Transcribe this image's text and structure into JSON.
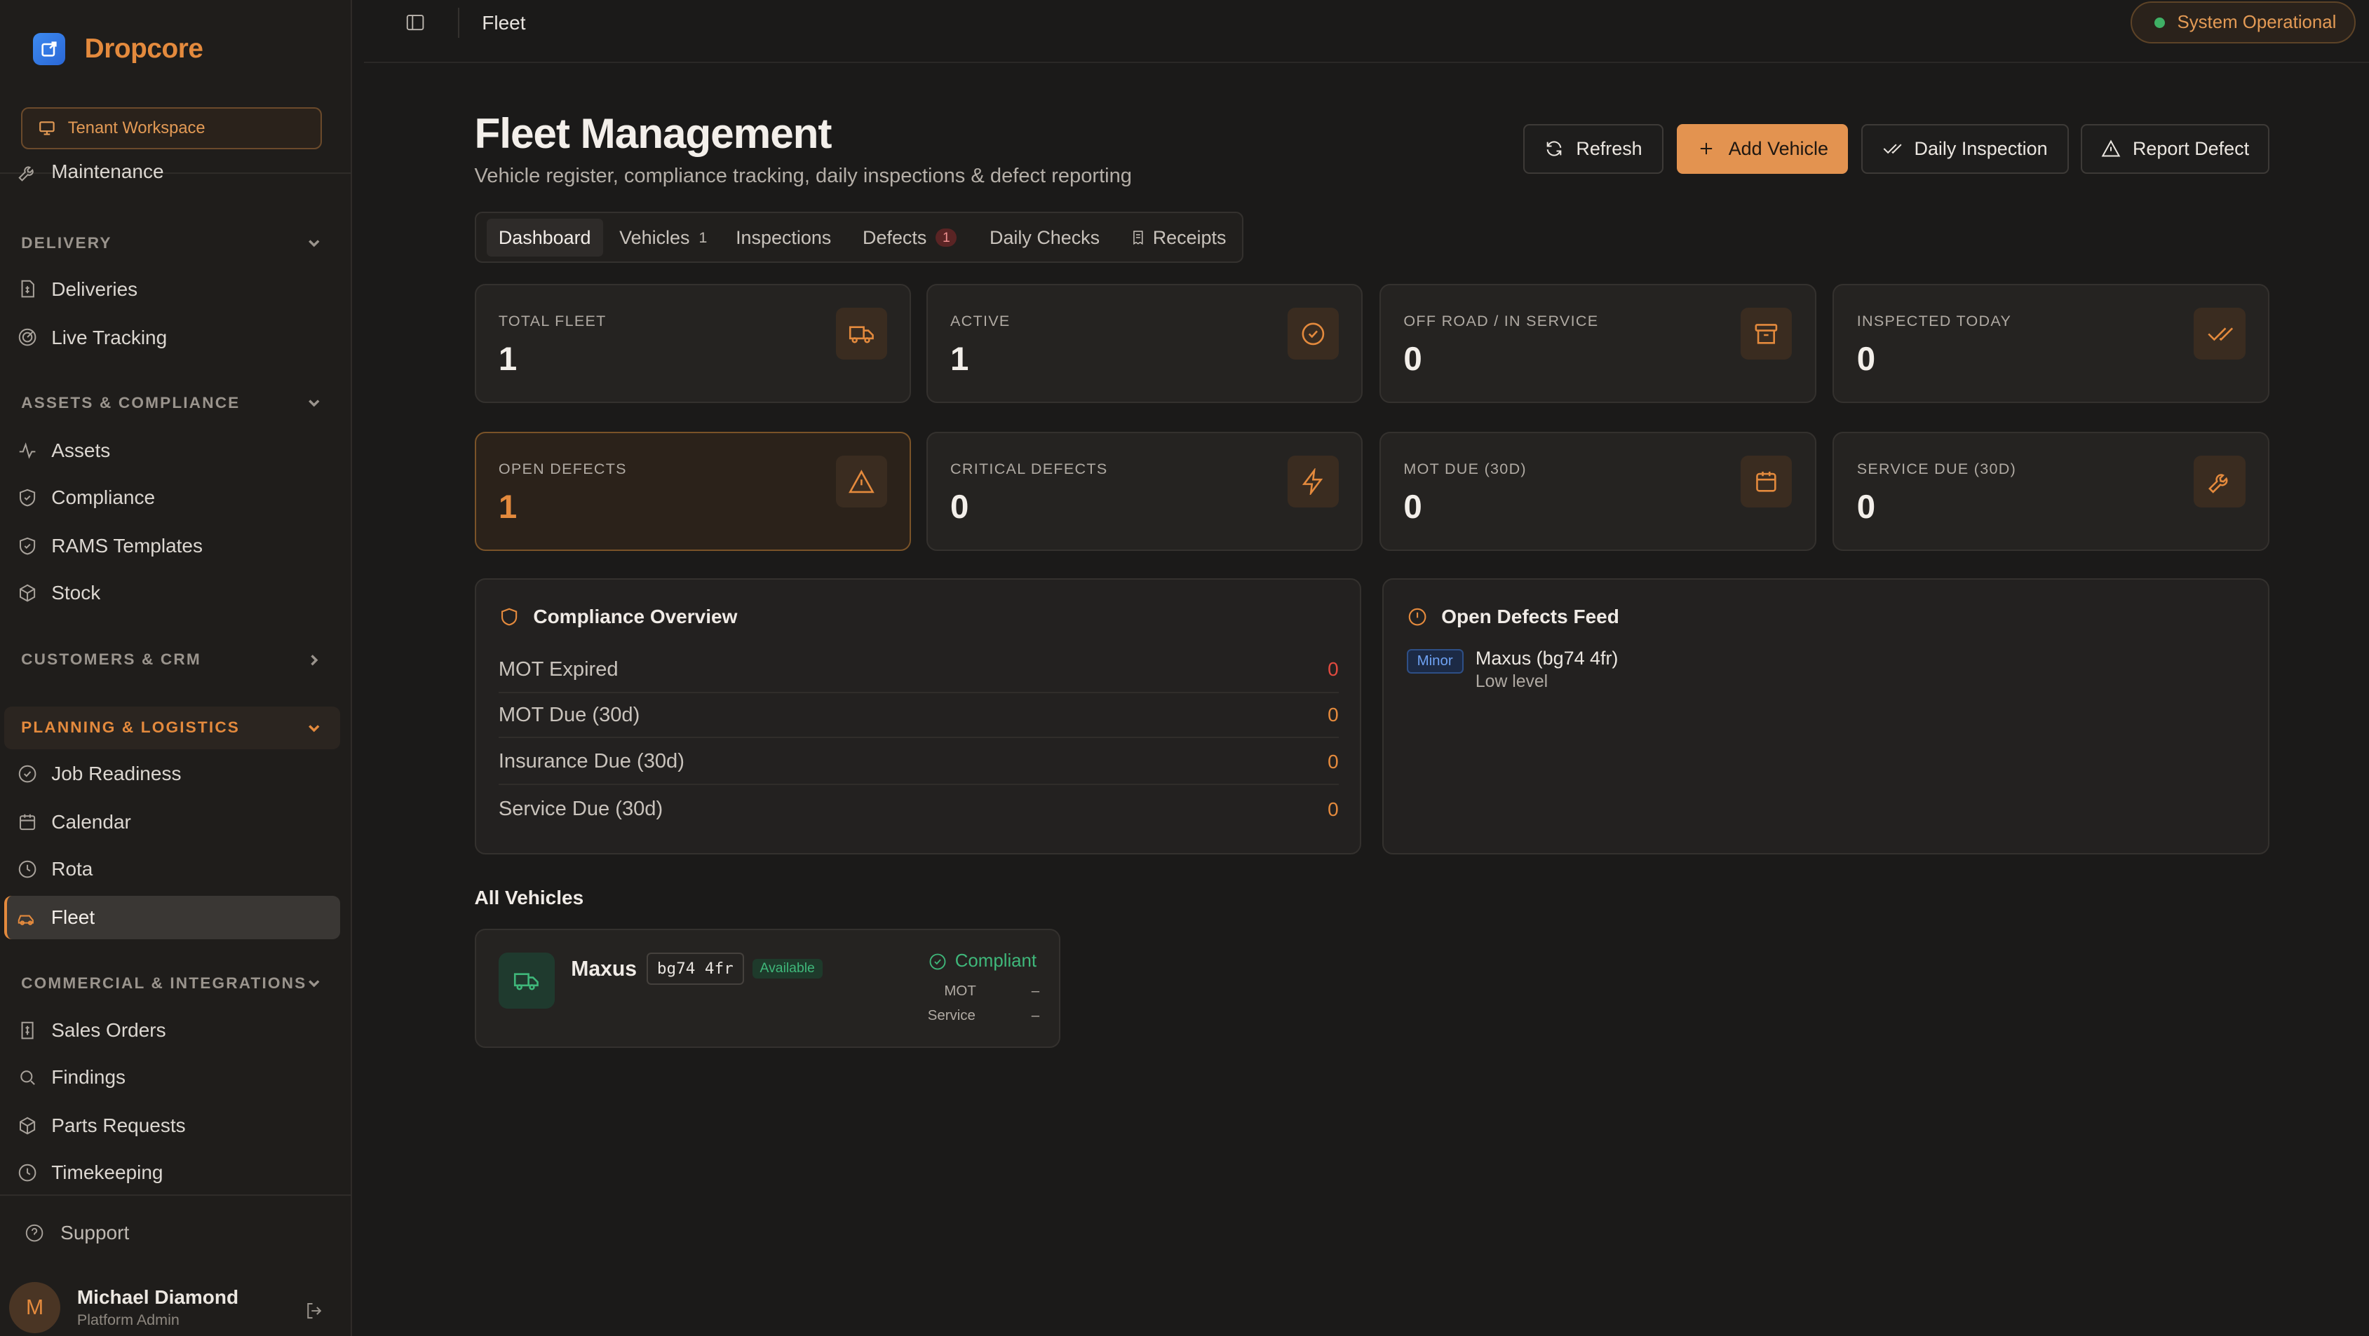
{
  "brand": {
    "name": "Dropcore"
  },
  "tenant": {
    "label": "Tenant Workspace"
  },
  "sidebar": {
    "top_partial": "Maintenance",
    "sections": [
      {
        "label": "DELIVERY",
        "items": [
          "Deliveries",
          "Live Tracking"
        ]
      },
      {
        "label": "ASSETS & COMPLIANCE",
        "items": [
          "Assets",
          "Compliance",
          "RAMS Templates",
          "Stock"
        ]
      },
      {
        "label": "CUSTOMERS & CRM",
        "items": []
      },
      {
        "label": "PLANNING & LOGISTICS",
        "items": [
          "Job Readiness",
          "Calendar",
          "Rota",
          "Fleet"
        ]
      },
      {
        "label": "COMMERCIAL & INTEGRATIONS",
        "items": [
          "Sales Orders",
          "Findings",
          "Parts Requests",
          "Timekeeping"
        ]
      }
    ],
    "active_item": "Fleet",
    "support": "Support"
  },
  "user": {
    "initial": "M",
    "name": "Michael Diamond",
    "role": "Platform Admin"
  },
  "topbar": {
    "breadcrumb": "Fleet",
    "status": "System Operational"
  },
  "header": {
    "title": "Fleet Management",
    "subtitle": "Vehicle register, compliance tracking, daily inspections & defect reporting",
    "buttons": {
      "refresh": "Refresh",
      "add": "Add Vehicle",
      "inspection": "Daily Inspection",
      "report": "Report Defect"
    }
  },
  "tabs": [
    {
      "label": "Dashboard"
    },
    {
      "label": "Vehicles",
      "count": "1"
    },
    {
      "label": "Inspections"
    },
    {
      "label": "Defects",
      "badge": "1"
    },
    {
      "label": "Daily Checks"
    },
    {
      "label": "Receipts"
    }
  ],
  "stats": [
    {
      "label": "TOTAL FLEET",
      "value": "1",
      "icon": "truck-icon"
    },
    {
      "label": "ACTIVE",
      "value": "1",
      "icon": "check-circle-icon"
    },
    {
      "label": "OFF ROAD / IN SERVICE",
      "value": "0",
      "icon": "archive-icon"
    },
    {
      "label": "INSPECTED TODAY",
      "value": "0",
      "icon": "double-check-icon"
    },
    {
      "label": "OPEN DEFECTS",
      "value": "1",
      "icon": "warning-icon"
    },
    {
      "label": "CRITICAL DEFECTS",
      "value": "0",
      "icon": "bolt-icon"
    },
    {
      "label": "MOT DUE (30D)",
      "value": "0",
      "icon": "calendar-icon"
    },
    {
      "label": "SERVICE DUE (30D)",
      "value": "0",
      "icon": "wrench-icon"
    }
  ],
  "compliance": {
    "title": "Compliance Overview",
    "rows": [
      {
        "label": "MOT Expired",
        "value": "0"
      },
      {
        "label": "MOT Due (30d)",
        "value": "0"
      },
      {
        "label": "Insurance Due (30d)",
        "value": "0"
      },
      {
        "label": "Service Due (30d)",
        "value": "0"
      }
    ]
  },
  "defects_feed": {
    "title": "Open Defects Feed",
    "items": [
      {
        "severity": "Minor",
        "vehicle": "Maxus (bg74 4fr)",
        "description": "Low level"
      }
    ]
  },
  "vehicles": {
    "title": "All Vehicles",
    "items": [
      {
        "name": "Maxus",
        "reg": "bg74 4fr",
        "availability": "Available",
        "status": "Compliant",
        "mot_label": "MOT",
        "mot_value": "–",
        "service_label": "Service",
        "service_value": "–"
      }
    ]
  },
  "colors": {
    "accent": "#e48a3d",
    "success": "#3fb77a",
    "danger": "#e04a3f",
    "info": "#6ea1f2"
  }
}
